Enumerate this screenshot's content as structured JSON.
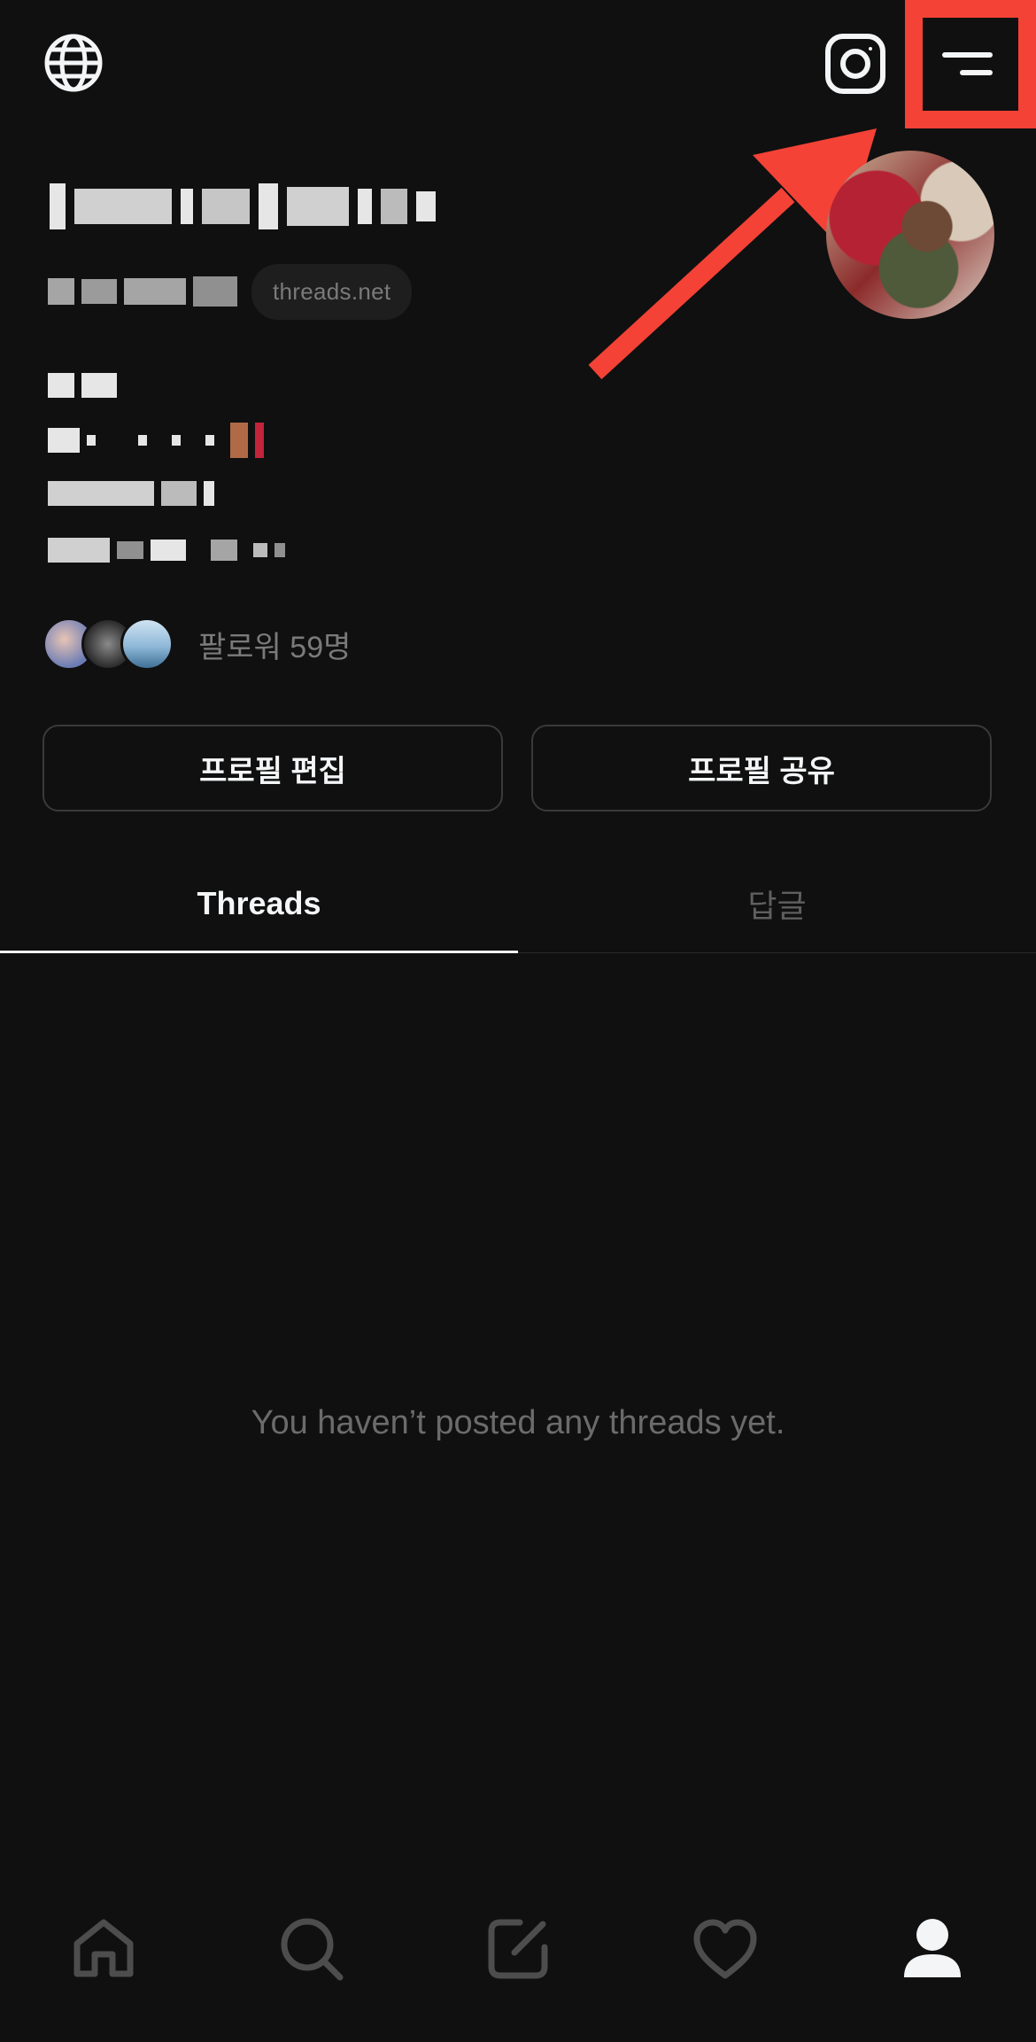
{
  "header": {
    "globe_icon": "globe-icon",
    "instagram_icon": "instagram-icon",
    "menu_icon": "menu-icon",
    "highlight_color": "#f44236"
  },
  "profile": {
    "domain_badge": "threads.net"
  },
  "followers": {
    "text": "팔로워 59명"
  },
  "actions": {
    "edit_profile": "프로필 편집",
    "share_profile": "프로필 공유"
  },
  "tabs": [
    {
      "label": "Threads",
      "active": true
    },
    {
      "label": "답글",
      "active": false
    }
  ],
  "feed": {
    "empty_message": "You haven’t posted any threads yet."
  },
  "bottom_nav": [
    {
      "icon": "home-icon"
    },
    {
      "icon": "search-icon"
    },
    {
      "icon": "compose-icon"
    },
    {
      "icon": "heart-icon"
    },
    {
      "icon": "profile-icon",
      "active": true
    }
  ]
}
